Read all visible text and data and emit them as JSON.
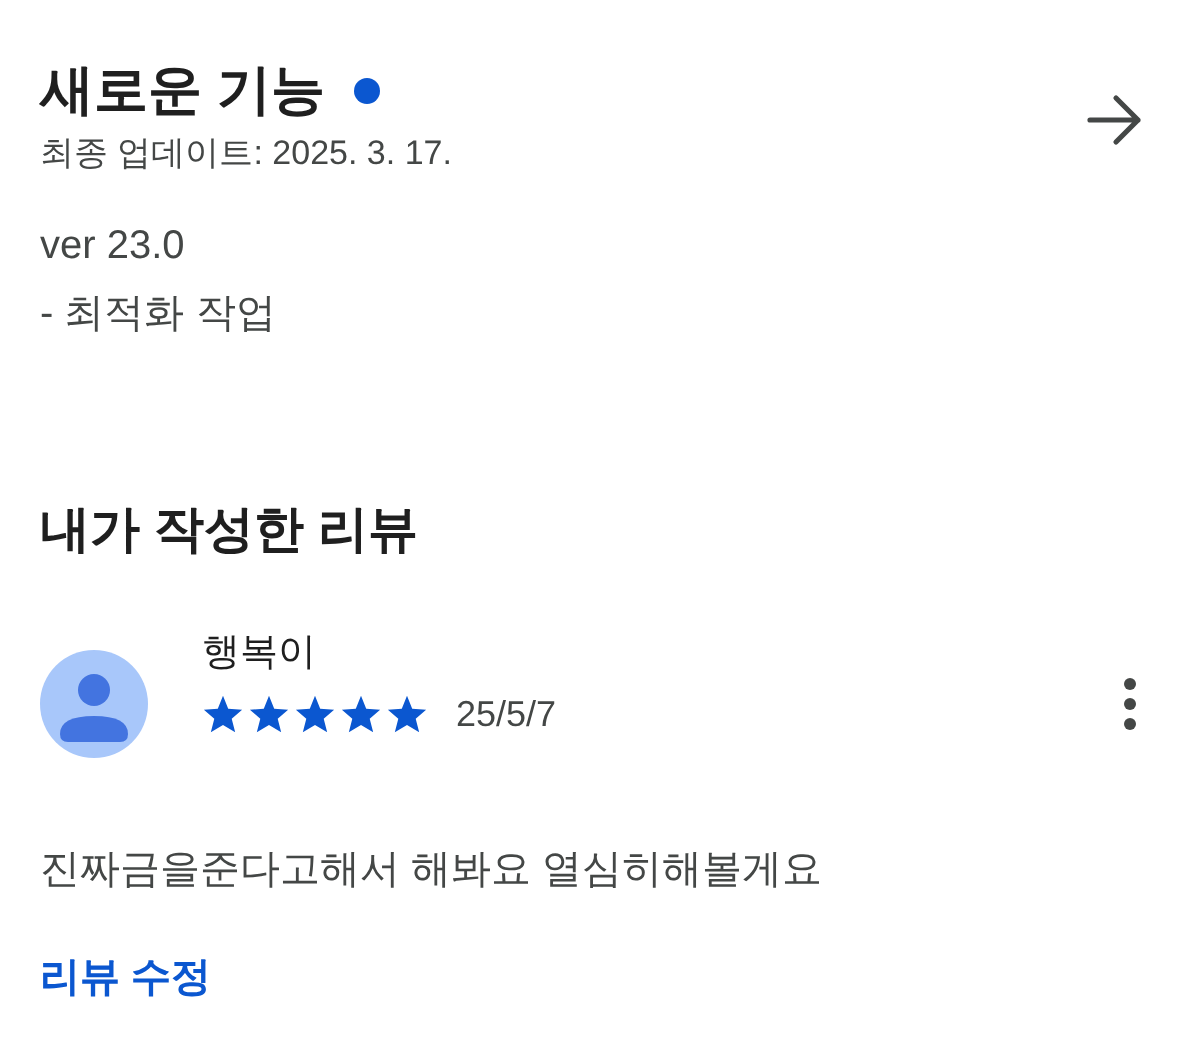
{
  "whats_new": {
    "title": "새로운 기능",
    "new_dot": true,
    "updated": "최종 업데이트: 2025. 3. 17.",
    "notes": [
      "ver 23.0",
      "- 최적화 작업"
    ]
  },
  "my_review": {
    "heading": "내가 작성한 리뷰",
    "author": "행복이",
    "stars": 5,
    "date": "25/5/7",
    "text": "진짜금을준다고해서 해봐요 열심히해볼게요",
    "edit_link": "리뷰 수정"
  }
}
